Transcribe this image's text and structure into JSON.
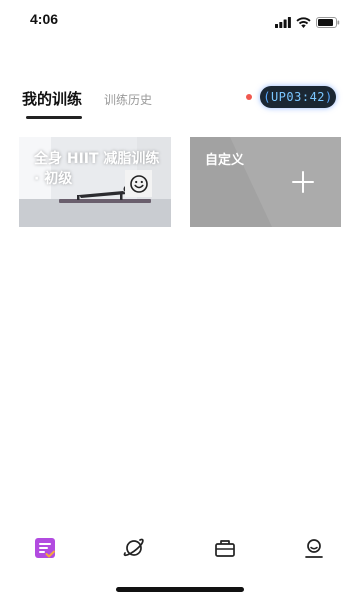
{
  "status_bar": {
    "time": "4:06",
    "icons": [
      "signal-icon",
      "wifi-icon",
      "battery-icon"
    ]
  },
  "tabs": {
    "active_label": "我的训练",
    "inactive_label": "训练历史"
  },
  "timer": {
    "prefix": "UP",
    "value": "03:42",
    "recording": true
  },
  "cards": [
    {
      "title": "全身 HIIT 减脂训练 · 初级",
      "icon": "smile-icon"
    },
    {
      "title": "自定义",
      "icon": "plus-icon"
    }
  ],
  "bottom_nav": [
    {
      "name": "training-tab",
      "icon": "clipboard-check-icon",
      "active": true,
      "color": "#b24be0"
    },
    {
      "name": "explore-tab",
      "icon": "planet-icon",
      "active": false
    },
    {
      "name": "shop-tab",
      "icon": "bag-icon",
      "active": false
    },
    {
      "name": "profile-tab",
      "icon": "user-icon",
      "active": false
    }
  ],
  "colors": {
    "accent": "#b24be0",
    "timer_text": "#7bc7ff",
    "record_dot": "#f0584f",
    "custom_card": "#a2a2a2"
  }
}
